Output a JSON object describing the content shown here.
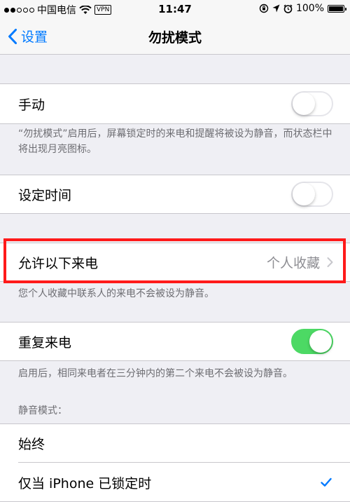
{
  "status_bar": {
    "carrier": "中国电信",
    "vpn": "VPN",
    "time": "11:47",
    "battery_percent": "100%",
    "signal_icon": "signal-dots-icon",
    "wifi_icon": "wifi-icon"
  },
  "nav": {
    "back_label": "设置",
    "title": "勿扰模式"
  },
  "manual": {
    "label": "手动",
    "enabled": false
  },
  "manual_footnote": "“勿扰模式”启用后，屏幕锁定时的来电和提醒将被设为静音，而状态栏中将出现月亮图标。",
  "scheduled": {
    "label": "设定时间",
    "enabled": false
  },
  "allow_calls": {
    "label": "允许以下来电",
    "value": "个人收藏"
  },
  "allow_calls_footnote": "您个人收藏中联系人的来电不会被设为静音。",
  "repeated_calls": {
    "label": "重复来电",
    "enabled": true
  },
  "repeated_calls_footnote": "启用后，相同来电者在三分钟内的第二个来电不会被设为静音。",
  "silence_header": "静音模式：",
  "silence_options": [
    {
      "label": "始终",
      "selected": false
    },
    {
      "label": "仅当 iPhone 已锁定时",
      "selected": true
    }
  ],
  "colors": {
    "accent": "#007aff",
    "toggle_on": "#4cd964",
    "highlight": "#ff1a1a"
  }
}
